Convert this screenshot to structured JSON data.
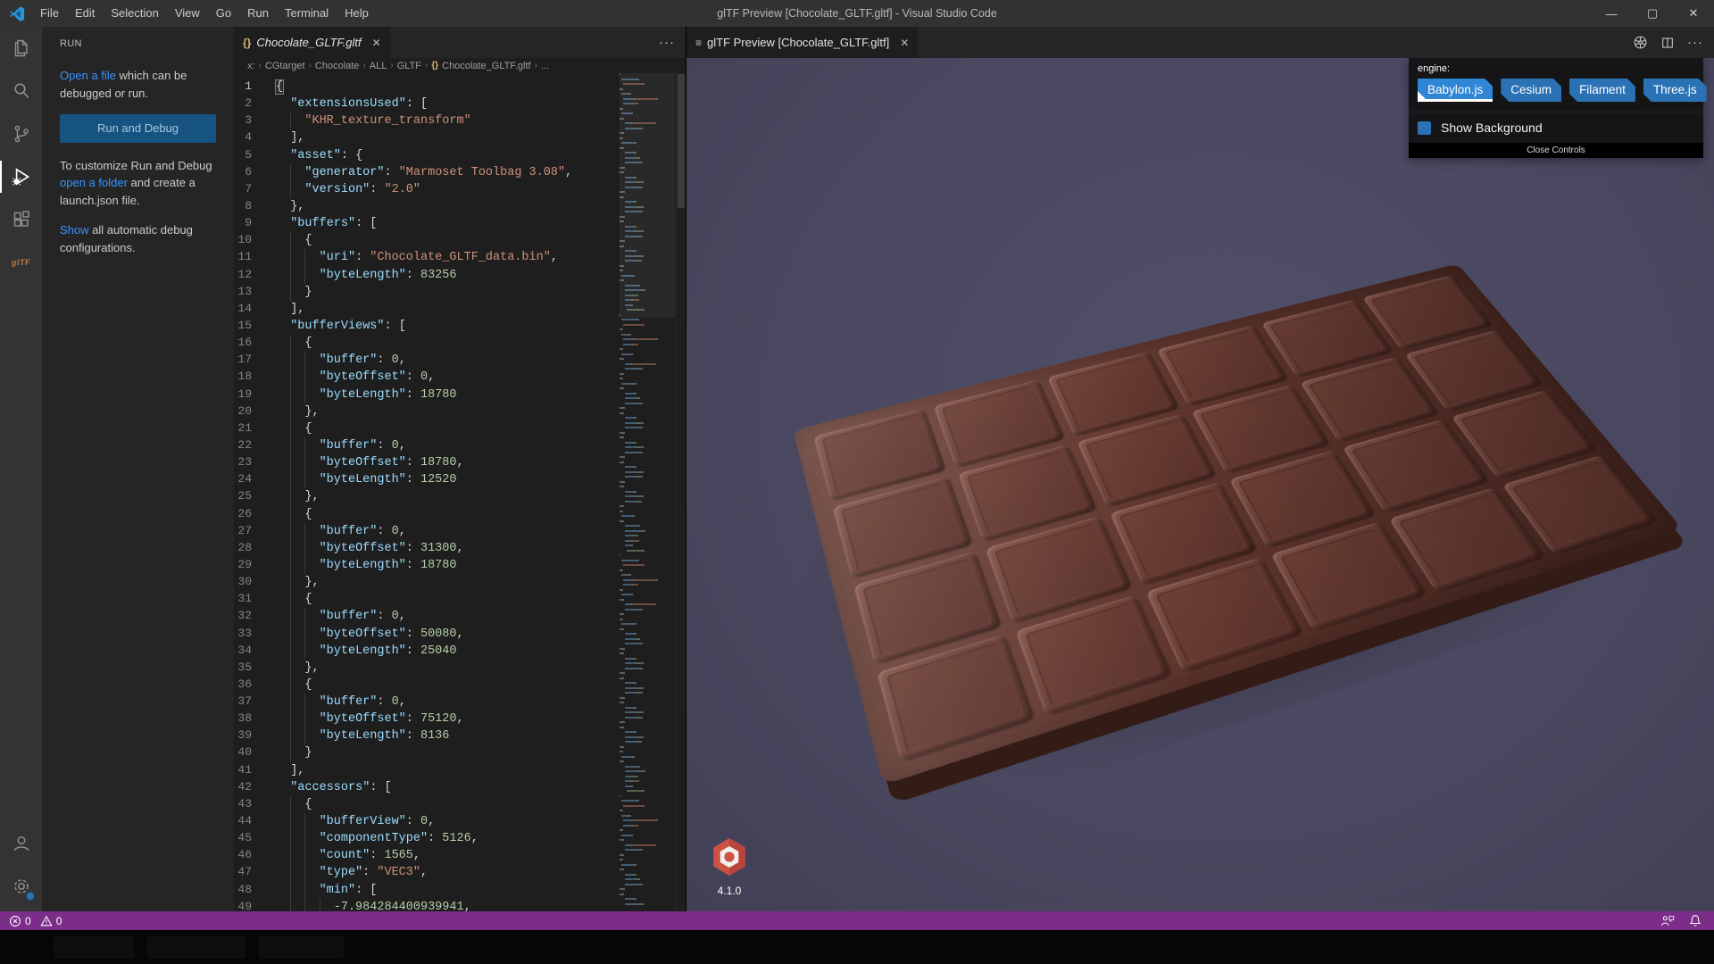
{
  "window": {
    "title": "glTF Preview [Chocolate_GLTF.gltf] - Visual Studio Code",
    "menus": [
      "File",
      "Edit",
      "Selection",
      "View",
      "Go",
      "Run",
      "Terminal",
      "Help"
    ]
  },
  "activity_bar": {
    "items": [
      "explorer",
      "search",
      "source-control",
      "run-and-debug",
      "extensions",
      "gltf-tools"
    ],
    "active": "run-and-debug"
  },
  "sidebar": {
    "title": "RUN",
    "open_file_link": "Open a file",
    "open_file_rest": " which can be debugged or run.",
    "run_button": "Run and Debug",
    "customize_pre": "To customize Run and Debug ",
    "customize_link": "open a folder",
    "customize_post": " and create a launch.json file.",
    "show_link": "Show",
    "show_rest": " all automatic debug configurations."
  },
  "editor": {
    "tab": {
      "icon": "{}",
      "label": "Chocolate_GLTF.gltf",
      "close": "✕"
    },
    "breadcrumb": [
      "x:",
      "CGtarget",
      "Chocolate",
      "ALL",
      "GLTF",
      "Chocolate_GLTF.gltf",
      "..."
    ],
    "code_lines": [
      [
        [
          "p",
          "{"
        ]
      ],
      [
        [
          "p",
          "  "
        ],
        [
          "k",
          "\"extensionsUsed\""
        ],
        [
          "p",
          ": ["
        ]
      ],
      [
        [
          "p",
          "    "
        ],
        [
          "s",
          "\"KHR_texture_transform\""
        ]
      ],
      [
        [
          "p",
          "  ],"
        ]
      ],
      [
        [
          "p",
          "  "
        ],
        [
          "k",
          "\"asset\""
        ],
        [
          "p",
          ": {"
        ]
      ],
      [
        [
          "p",
          "    "
        ],
        [
          "k",
          "\"generator\""
        ],
        [
          "p",
          ": "
        ],
        [
          "s",
          "\"Marmoset Toolbag 3.08\""
        ],
        [
          "p",
          ","
        ]
      ],
      [
        [
          "p",
          "    "
        ],
        [
          "k",
          "\"version\""
        ],
        [
          "p",
          ": "
        ],
        [
          "s",
          "\"2.0\""
        ]
      ],
      [
        [
          "p",
          "  },"
        ]
      ],
      [
        [
          "p",
          "  "
        ],
        [
          "k",
          "\"buffers\""
        ],
        [
          "p",
          ": ["
        ]
      ],
      [
        [
          "p",
          "    {"
        ]
      ],
      [
        [
          "p",
          "      "
        ],
        [
          "k",
          "\"uri\""
        ],
        [
          "p",
          ": "
        ],
        [
          "s",
          "\"Chocolate_GLTF_data.bin\""
        ],
        [
          "p",
          ","
        ]
      ],
      [
        [
          "p",
          "      "
        ],
        [
          "k",
          "\"byteLength\""
        ],
        [
          "p",
          ": "
        ],
        [
          "n",
          "83256"
        ]
      ],
      [
        [
          "p",
          "    }"
        ]
      ],
      [
        [
          "p",
          "  ],"
        ]
      ],
      [
        [
          "p",
          "  "
        ],
        [
          "k",
          "\"bufferViews\""
        ],
        [
          "p",
          ": ["
        ]
      ],
      [
        [
          "p",
          "    {"
        ]
      ],
      [
        [
          "p",
          "      "
        ],
        [
          "k",
          "\"buffer\""
        ],
        [
          "p",
          ": "
        ],
        [
          "n",
          "0"
        ],
        [
          "p",
          ","
        ]
      ],
      [
        [
          "p",
          "      "
        ],
        [
          "k",
          "\"byteOffset\""
        ],
        [
          "p",
          ": "
        ],
        [
          "n",
          "0"
        ],
        [
          "p",
          ","
        ]
      ],
      [
        [
          "p",
          "      "
        ],
        [
          "k",
          "\"byteLength\""
        ],
        [
          "p",
          ": "
        ],
        [
          "n",
          "18780"
        ]
      ],
      [
        [
          "p",
          "    },"
        ]
      ],
      [
        [
          "p",
          "    {"
        ]
      ],
      [
        [
          "p",
          "      "
        ],
        [
          "k",
          "\"buffer\""
        ],
        [
          "p",
          ": "
        ],
        [
          "n",
          "0"
        ],
        [
          "p",
          ","
        ]
      ],
      [
        [
          "p",
          "      "
        ],
        [
          "k",
          "\"byteOffset\""
        ],
        [
          "p",
          ": "
        ],
        [
          "n",
          "18780"
        ],
        [
          "p",
          ","
        ]
      ],
      [
        [
          "p",
          "      "
        ],
        [
          "k",
          "\"byteLength\""
        ],
        [
          "p",
          ": "
        ],
        [
          "n",
          "12520"
        ]
      ],
      [
        [
          "p",
          "    },"
        ]
      ],
      [
        [
          "p",
          "    {"
        ]
      ],
      [
        [
          "p",
          "      "
        ],
        [
          "k",
          "\"buffer\""
        ],
        [
          "p",
          ": "
        ],
        [
          "n",
          "0"
        ],
        [
          "p",
          ","
        ]
      ],
      [
        [
          "p",
          "      "
        ],
        [
          "k",
          "\"byteOffset\""
        ],
        [
          "p",
          ": "
        ],
        [
          "n",
          "31300"
        ],
        [
          "p",
          ","
        ]
      ],
      [
        [
          "p",
          "      "
        ],
        [
          "k",
          "\"byteLength\""
        ],
        [
          "p",
          ": "
        ],
        [
          "n",
          "18780"
        ]
      ],
      [
        [
          "p",
          "    },"
        ]
      ],
      [
        [
          "p",
          "    {"
        ]
      ],
      [
        [
          "p",
          "      "
        ],
        [
          "k",
          "\"buffer\""
        ],
        [
          "p",
          ": "
        ],
        [
          "n",
          "0"
        ],
        [
          "p",
          ","
        ]
      ],
      [
        [
          "p",
          "      "
        ],
        [
          "k",
          "\"byteOffset\""
        ],
        [
          "p",
          ": "
        ],
        [
          "n",
          "50080"
        ],
        [
          "p",
          ","
        ]
      ],
      [
        [
          "p",
          "      "
        ],
        [
          "k",
          "\"byteLength\""
        ],
        [
          "p",
          ": "
        ],
        [
          "n",
          "25040"
        ]
      ],
      [
        [
          "p",
          "    },"
        ]
      ],
      [
        [
          "p",
          "    {"
        ]
      ],
      [
        [
          "p",
          "      "
        ],
        [
          "k",
          "\"buffer\""
        ],
        [
          "p",
          ": "
        ],
        [
          "n",
          "0"
        ],
        [
          "p",
          ","
        ]
      ],
      [
        [
          "p",
          "      "
        ],
        [
          "k",
          "\"byteOffset\""
        ],
        [
          "p",
          ": "
        ],
        [
          "n",
          "75120"
        ],
        [
          "p",
          ","
        ]
      ],
      [
        [
          "p",
          "      "
        ],
        [
          "k",
          "\"byteLength\""
        ],
        [
          "p",
          ": "
        ],
        [
          "n",
          "8136"
        ]
      ],
      [
        [
          "p",
          "    }"
        ]
      ],
      [
        [
          "p",
          "  ],"
        ]
      ],
      [
        [
          "p",
          "  "
        ],
        [
          "k",
          "\"accessors\""
        ],
        [
          "p",
          ": ["
        ]
      ],
      [
        [
          "p",
          "    {"
        ]
      ],
      [
        [
          "p",
          "      "
        ],
        [
          "k",
          "\"bufferView\""
        ],
        [
          "p",
          ": "
        ],
        [
          "n",
          "0"
        ],
        [
          "p",
          ","
        ]
      ],
      [
        [
          "p",
          "      "
        ],
        [
          "k",
          "\"componentType\""
        ],
        [
          "p",
          ": "
        ],
        [
          "n",
          "5126"
        ],
        [
          "p",
          ","
        ]
      ],
      [
        [
          "p",
          "      "
        ],
        [
          "k",
          "\"count\""
        ],
        [
          "p",
          ": "
        ],
        [
          "n",
          "1565"
        ],
        [
          "p",
          ","
        ]
      ],
      [
        [
          "p",
          "      "
        ],
        [
          "k",
          "\"type\""
        ],
        [
          "p",
          ": "
        ],
        [
          "s",
          "\"VEC3\""
        ],
        [
          "p",
          ","
        ]
      ],
      [
        [
          "p",
          "      "
        ],
        [
          "k",
          "\"min\""
        ],
        [
          "p",
          ": ["
        ]
      ],
      [
        [
          "p",
          "        "
        ],
        [
          "n",
          "-7.984284400939941"
        ],
        [
          "p",
          ","
        ]
      ]
    ]
  },
  "preview": {
    "tab": {
      "label": "glTF Preview [Chocolate_GLTF.gltf]",
      "close": "✕"
    },
    "engine_label": "engine:",
    "engines": [
      "Babylon.js",
      "Cesium",
      "Filament",
      "Three.js"
    ],
    "active_engine": "Babylon.js",
    "show_background_label": "Show Background",
    "show_background_checked": false,
    "close_controls_label": "Close Controls",
    "version": "4.1.0"
  },
  "status_bar": {
    "errors": "0",
    "warnings": "0"
  },
  "colors": {
    "status_bar": "#7c2d8a",
    "engine_accent": "#2a72b5",
    "engine_active": "#2f86d4",
    "viewport_bg": "#4a4860",
    "chocolate": "#5e352c",
    "link": "#3794ff",
    "code_key": "#9cdcfe",
    "code_string": "#ce9178",
    "code_number": "#b5cea8"
  }
}
